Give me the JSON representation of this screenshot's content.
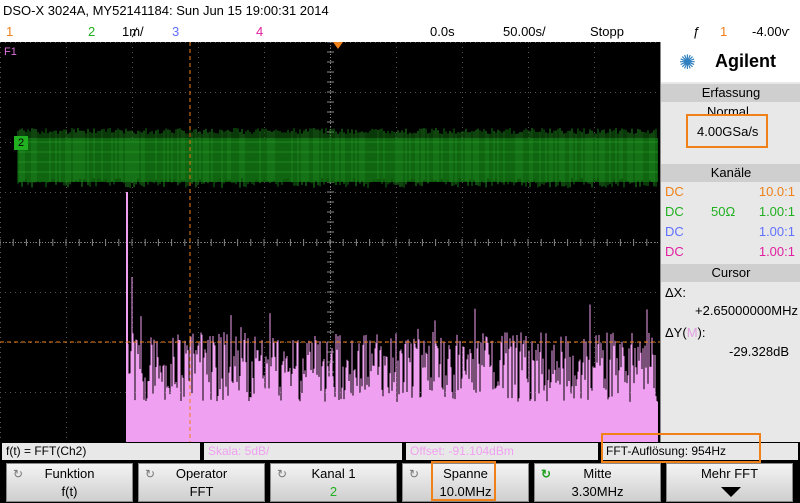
{
  "title": {
    "model": "DSO-X 3024A, MY52141184: Sun Jun 15 19:00:31 2014"
  },
  "status": {
    "ch1": "1",
    "ch2": "2",
    "ch3_label": "1₥/",
    "ch3": "3",
    "ch4": "4",
    "time_offset": "0.0s",
    "time_div": "50.00ѕ/",
    "run_state": "Stopp",
    "trigger_symbol": "ƒ",
    "trigger_ch": "1",
    "trigger_level": "-4.00ѵ"
  },
  "markers": {
    "f1": "F1",
    "ch2_marker": "2"
  },
  "panel": {
    "brand": "Agilent",
    "acquisition_header": "Erfassung",
    "acq_mode": "Normal",
    "sample_rate": "4.00GSa/s",
    "channels_header": "Kanäle",
    "channels": [
      {
        "coupling": "DC",
        "imp": "",
        "probe": "10.0:1",
        "color": "#f08018"
      },
      {
        "coupling": "DC",
        "imp": "50Ω",
        "probe": "1.00:1",
        "color": "#20b020"
      },
      {
        "coupling": "DC",
        "imp": "",
        "probe": "1.00:1",
        "color": "#6070ff"
      },
      {
        "coupling": "DC",
        "imp": "",
        "probe": "1.00:1",
        "color": "#e020a0"
      }
    ],
    "cursor_header": "Cursor",
    "dx_label": "ΔX:",
    "dx_value": "+2.65000000MHz",
    "dy_label_prefix": "ΔY(",
    "dy_label_m": "M",
    "dy_label_suffix": "):",
    "dy_value": "-29.328dB"
  },
  "bottom": {
    "func": "f(t) = FFT(Ch2)",
    "scale": "Skala: 5dB/",
    "offset": "Offset: -91.104dBm",
    "resolution": "FFT-Auflösung: 954Hz"
  },
  "softkeys": [
    {
      "label": "Funktion",
      "value": "f(t)"
    },
    {
      "label": "Operator",
      "value": "FFT"
    },
    {
      "label": "Kanal 1",
      "value": "2"
    },
    {
      "label": "Spanne",
      "value": "10.0MHz"
    },
    {
      "label": "Mitte",
      "value": "3.30MHz"
    },
    {
      "label": "Mehr FFT",
      "value": ""
    }
  ],
  "colors": {
    "ch1": "#f08018",
    "ch2": "#20b020",
    "ch3": "#6070ff",
    "ch4": "#e020a0",
    "fft": "#f0a0f0",
    "highlight": "#f08018"
  }
}
